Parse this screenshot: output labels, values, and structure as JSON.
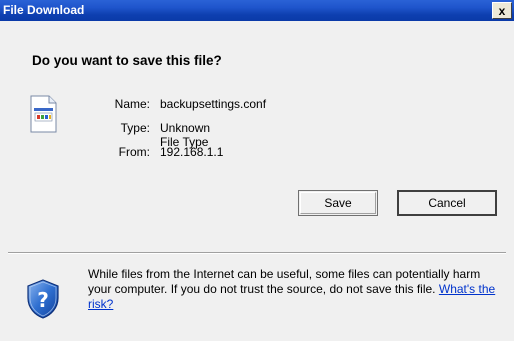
{
  "window": {
    "title": "File Download",
    "close_label": "x"
  },
  "dialog": {
    "question": "Do you want to save this file?",
    "file": {
      "icon": "unknown-file-icon",
      "name_label": "Name:",
      "name_value": "backupsettings.conf",
      "type_label": "Type:",
      "type_value": "Unknown File Type",
      "from_label": "From:",
      "from_value": "192.168.1.1"
    },
    "buttons": {
      "save_label": "Save",
      "cancel_label": "Cancel"
    },
    "warning": {
      "icon": "shield-question-icon",
      "text": "While files from the Internet can be useful, some files can potentially harm your computer. If you do not trust the source, do not save this file.",
      "link_label": "What's the risk?"
    }
  }
}
